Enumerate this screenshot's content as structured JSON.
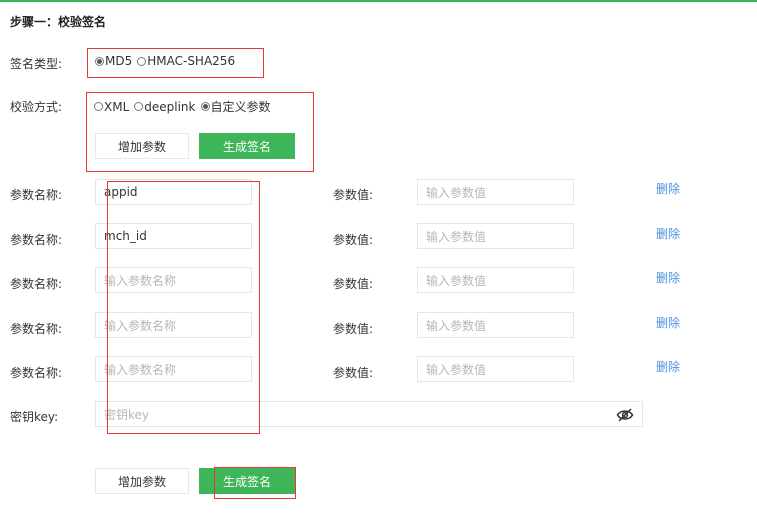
{
  "step_title": "步骤一：校验签名",
  "sign_type": {
    "label": "签名类型:",
    "options": [
      {
        "label": "MD5",
        "selected": true
      },
      {
        "label": "HMAC-SHA256",
        "selected": false
      }
    ]
  },
  "verify_method": {
    "label": "校验方式:",
    "options": [
      {
        "label": "XML",
        "selected": false
      },
      {
        "label": "deeplink",
        "selected": false
      },
      {
        "label": "自定义参数",
        "selected": true
      }
    ]
  },
  "buttons": {
    "add_param": "增加参数",
    "generate_sign": "生成签名"
  },
  "params": {
    "name_label": "参数名称:",
    "value_label": "参数值:",
    "name_placeholder": "输入参数名称",
    "value_placeholder": "输入参数值",
    "delete_label": "删除",
    "rows": [
      {
        "name": "appid",
        "value": ""
      },
      {
        "name": "mch_id",
        "value": ""
      },
      {
        "name": "",
        "value": ""
      },
      {
        "name": "",
        "value": ""
      },
      {
        "name": "",
        "value": ""
      }
    ]
  },
  "secret_key": {
    "label": "密钥key:",
    "placeholder": "密钥key",
    "value": "",
    "visibility_icon": "eye-off-icon"
  },
  "colors": {
    "accent_green": "#3fb55a",
    "link_blue": "#4a90e2",
    "highlight_red": "#e53838"
  }
}
